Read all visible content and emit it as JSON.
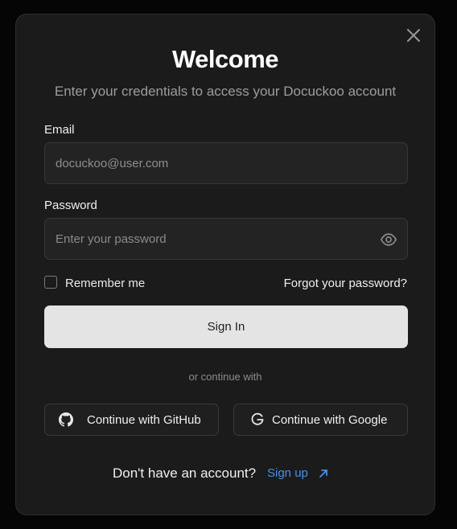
{
  "dialog": {
    "title": "Welcome",
    "subtitle": "Enter your credentials to access your Docuckoo account",
    "close_icon": "close-icon"
  },
  "form": {
    "email_label": "Email",
    "email_value": "docuckoo@user.com",
    "password_label": "Password",
    "password_placeholder": "Enter your password",
    "password_toggle_icon": "eye-icon",
    "remember_label": "Remember me",
    "remember_checked": false,
    "forgot_label": "Forgot your password?",
    "signin_label": "Sign In"
  },
  "social": {
    "divider_text": "or continue with",
    "github_label": "Continue with GitHub",
    "github_icon": "github-icon",
    "google_label": "Continue with Google",
    "google_icon": "google-icon"
  },
  "footer": {
    "prompt": "Don't have an account?",
    "signup_label": "Sign up",
    "signup_icon": "arrow-up-right-icon"
  },
  "colors": {
    "background": "#050505",
    "panel": "#1b1b1b",
    "field": "#232323",
    "button": "#e4e4e4",
    "link": "#4a90e2"
  }
}
